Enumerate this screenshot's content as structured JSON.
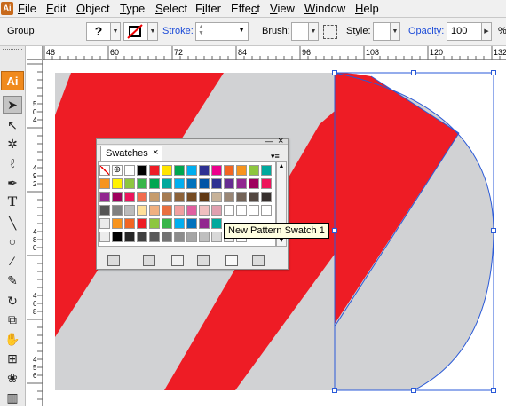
{
  "menubar": {
    "items": [
      "File",
      "Edit",
      "Object",
      "Type",
      "Select",
      "Filter",
      "Effect",
      "View",
      "Window",
      "Help"
    ],
    "underline": [
      "F",
      "E",
      "O",
      "T",
      "S",
      "i",
      "c",
      "V",
      "W",
      "H"
    ],
    "app_icon_text": "Ai"
  },
  "controlbar": {
    "selection_label": "Group",
    "stroke_label": "Stroke:",
    "brush_label": "Brush:",
    "style_label": "Style:",
    "opacity_label": "Opacity:",
    "opacity_value": "100",
    "opacity_unit": "%",
    "fill_glyph": "?"
  },
  "toolbox": {
    "logo": "Ai",
    "tools": [
      "selection-tool",
      "direct-selection-tool",
      "magic-wand-tool",
      "lasso-tool",
      "pen-tool",
      "type-tool",
      "line-tool",
      "ellipse-tool",
      "paintbrush-tool",
      "pencil-tool",
      "rotate-tool",
      "scale-tool",
      "warp-tool",
      "free-transform-tool",
      "symbol-sprayer-tool",
      "column-graph-tool"
    ]
  },
  "ruler": {
    "top_labels": [
      "48",
      "60",
      "72",
      "84",
      "96",
      "108",
      "120",
      "132"
    ],
    "left_labels": [
      "5\n0\n4",
      "4\n9\n2",
      "4\n8\n0",
      "4\n6\n8",
      "4\n5\n6"
    ]
  },
  "swatches_panel": {
    "tab_title": "Swatches",
    "close_glyph": "×",
    "minimize_glyph": "—",
    "menu_glyph": "▾≡",
    "tooltip": "New Pattern Swatch 1"
  },
  "artwork": {
    "red_color": "#ee1c25",
    "gray_color": "#d1d2d4",
    "selection_color": "#2a5ad8"
  }
}
